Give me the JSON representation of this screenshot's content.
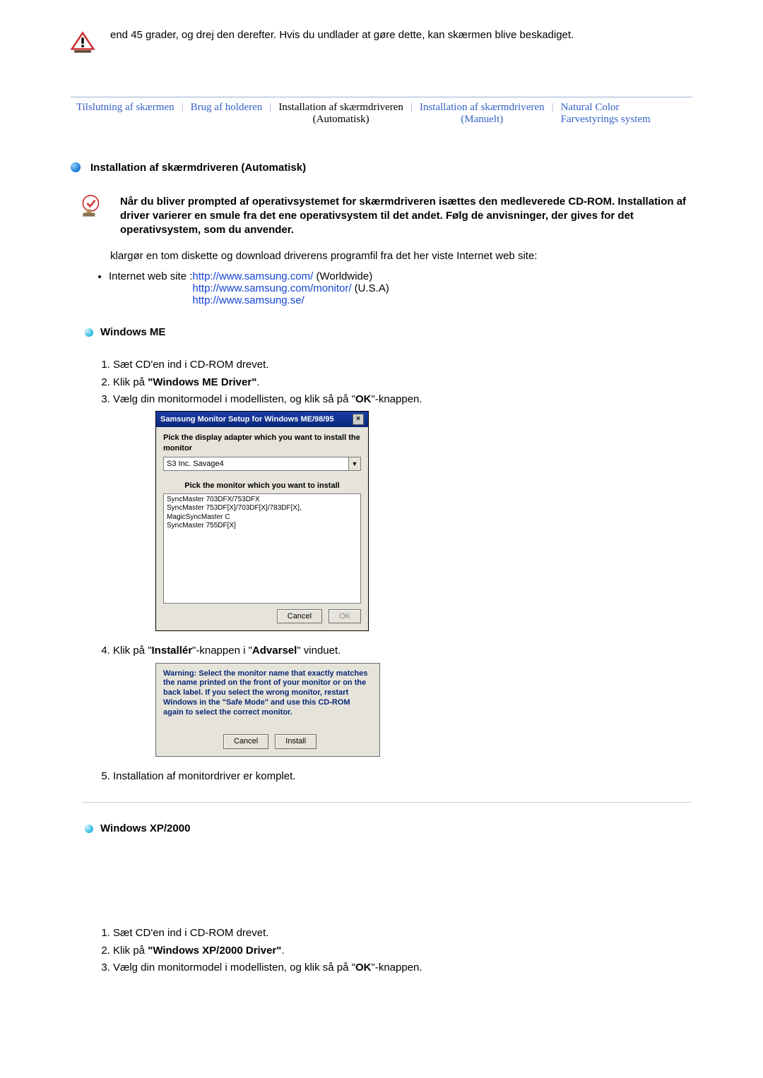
{
  "warning": {
    "text": "end 45 grader, og drej den derefter. Hvis du undlader at gøre dette, kan skærmen blive beskadiget."
  },
  "tabs": {
    "t1": "Tilslutning af skærmen",
    "t2": "Brug af holderen",
    "t3_line1": "Installation af skærmdriveren",
    "t3_line2": "(Automatisk)",
    "t4_line1": "Installation af skærmdriveren",
    "t4_line2": "(Manuelt)",
    "t5_line1": "Natural Color",
    "t5_line2": "Farvestyrings system"
  },
  "section": {
    "heading": "Installation af skærmdriveren (Automatisk)",
    "prompt": "Når du bliver prompted af operativsystemet for skærmdriveren isættes den medleverede CD-ROM. Installation af driver varierer en smule fra det ene operativsystem til det andet. Følg de anvisninger, der gives for det operativsystem, som du anvender.",
    "prepare": "klargør en tom diskette og download driverens programfil fra det her viste Internet web site:"
  },
  "links": {
    "label": "Internet web site :",
    "l1": "http://www.samsung.com/",
    "l1_suffix": " (Worldwide)",
    "l2": "http://www.samsung.com/monitor/",
    "l2_suffix": " (U.S.A)",
    "l3": "http://www.samsung.se/"
  },
  "winme": {
    "heading": "Windows ME",
    "s1": "Sæt CD'en ind i CD-ROM drevet.",
    "s2_a": "Klik på ",
    "s2_b": "\"Windows ME Driver\"",
    "s2_c": ".",
    "s3_a": "Vælg din monitormodel i modellisten, og klik så på \"",
    "s3_b": "OK",
    "s3_c": "\"-knappen.",
    "s4_a": "Klik på \"",
    "s4_b": "Installér",
    "s4_c": "\"-knappen i \"",
    "s4_d": "Advarsel",
    "s4_e": "\" vinduet.",
    "s5": "Installation af monitordriver er komplet."
  },
  "dlg1": {
    "title": "Samsung Monitor Setup for Windows ME/98/95",
    "label1": "Pick the display adapter which you want to install the monitor",
    "select": "S3 Inc. Savage4",
    "label2": "Pick the monitor which you want to install",
    "row1": "SyncMaster 703DFX/753DFX",
    "row2": "SyncMaster 753DF[X]/703DF[X]/783DF[X], MagicSyncMaster C",
    "row3": "SyncMaster 755DF[X]",
    "cancel": "Cancel",
    "ok": "OK"
  },
  "dlg2": {
    "text": "Warning: Select the monitor name that exactly matches the name printed on the front of your monitor or on the back label. If you select the wrong monitor, restart Windows in the \"Safe Mode\" and use this CD-ROM again to select the correct monitor.",
    "cancel": "Cancel",
    "install": "Install"
  },
  "winxp": {
    "heading": "Windows XP/2000",
    "s1": "Sæt CD'en ind i CD-ROM drevet.",
    "s2_a": "Klik på ",
    "s2_b": "\"Windows XP/2000 Driver\"",
    "s2_c": ".",
    "s3_a": "Vælg din monitormodel i modellisten, og klik så på \"",
    "s3_b": "OK",
    "s3_c": "\"-knappen."
  }
}
